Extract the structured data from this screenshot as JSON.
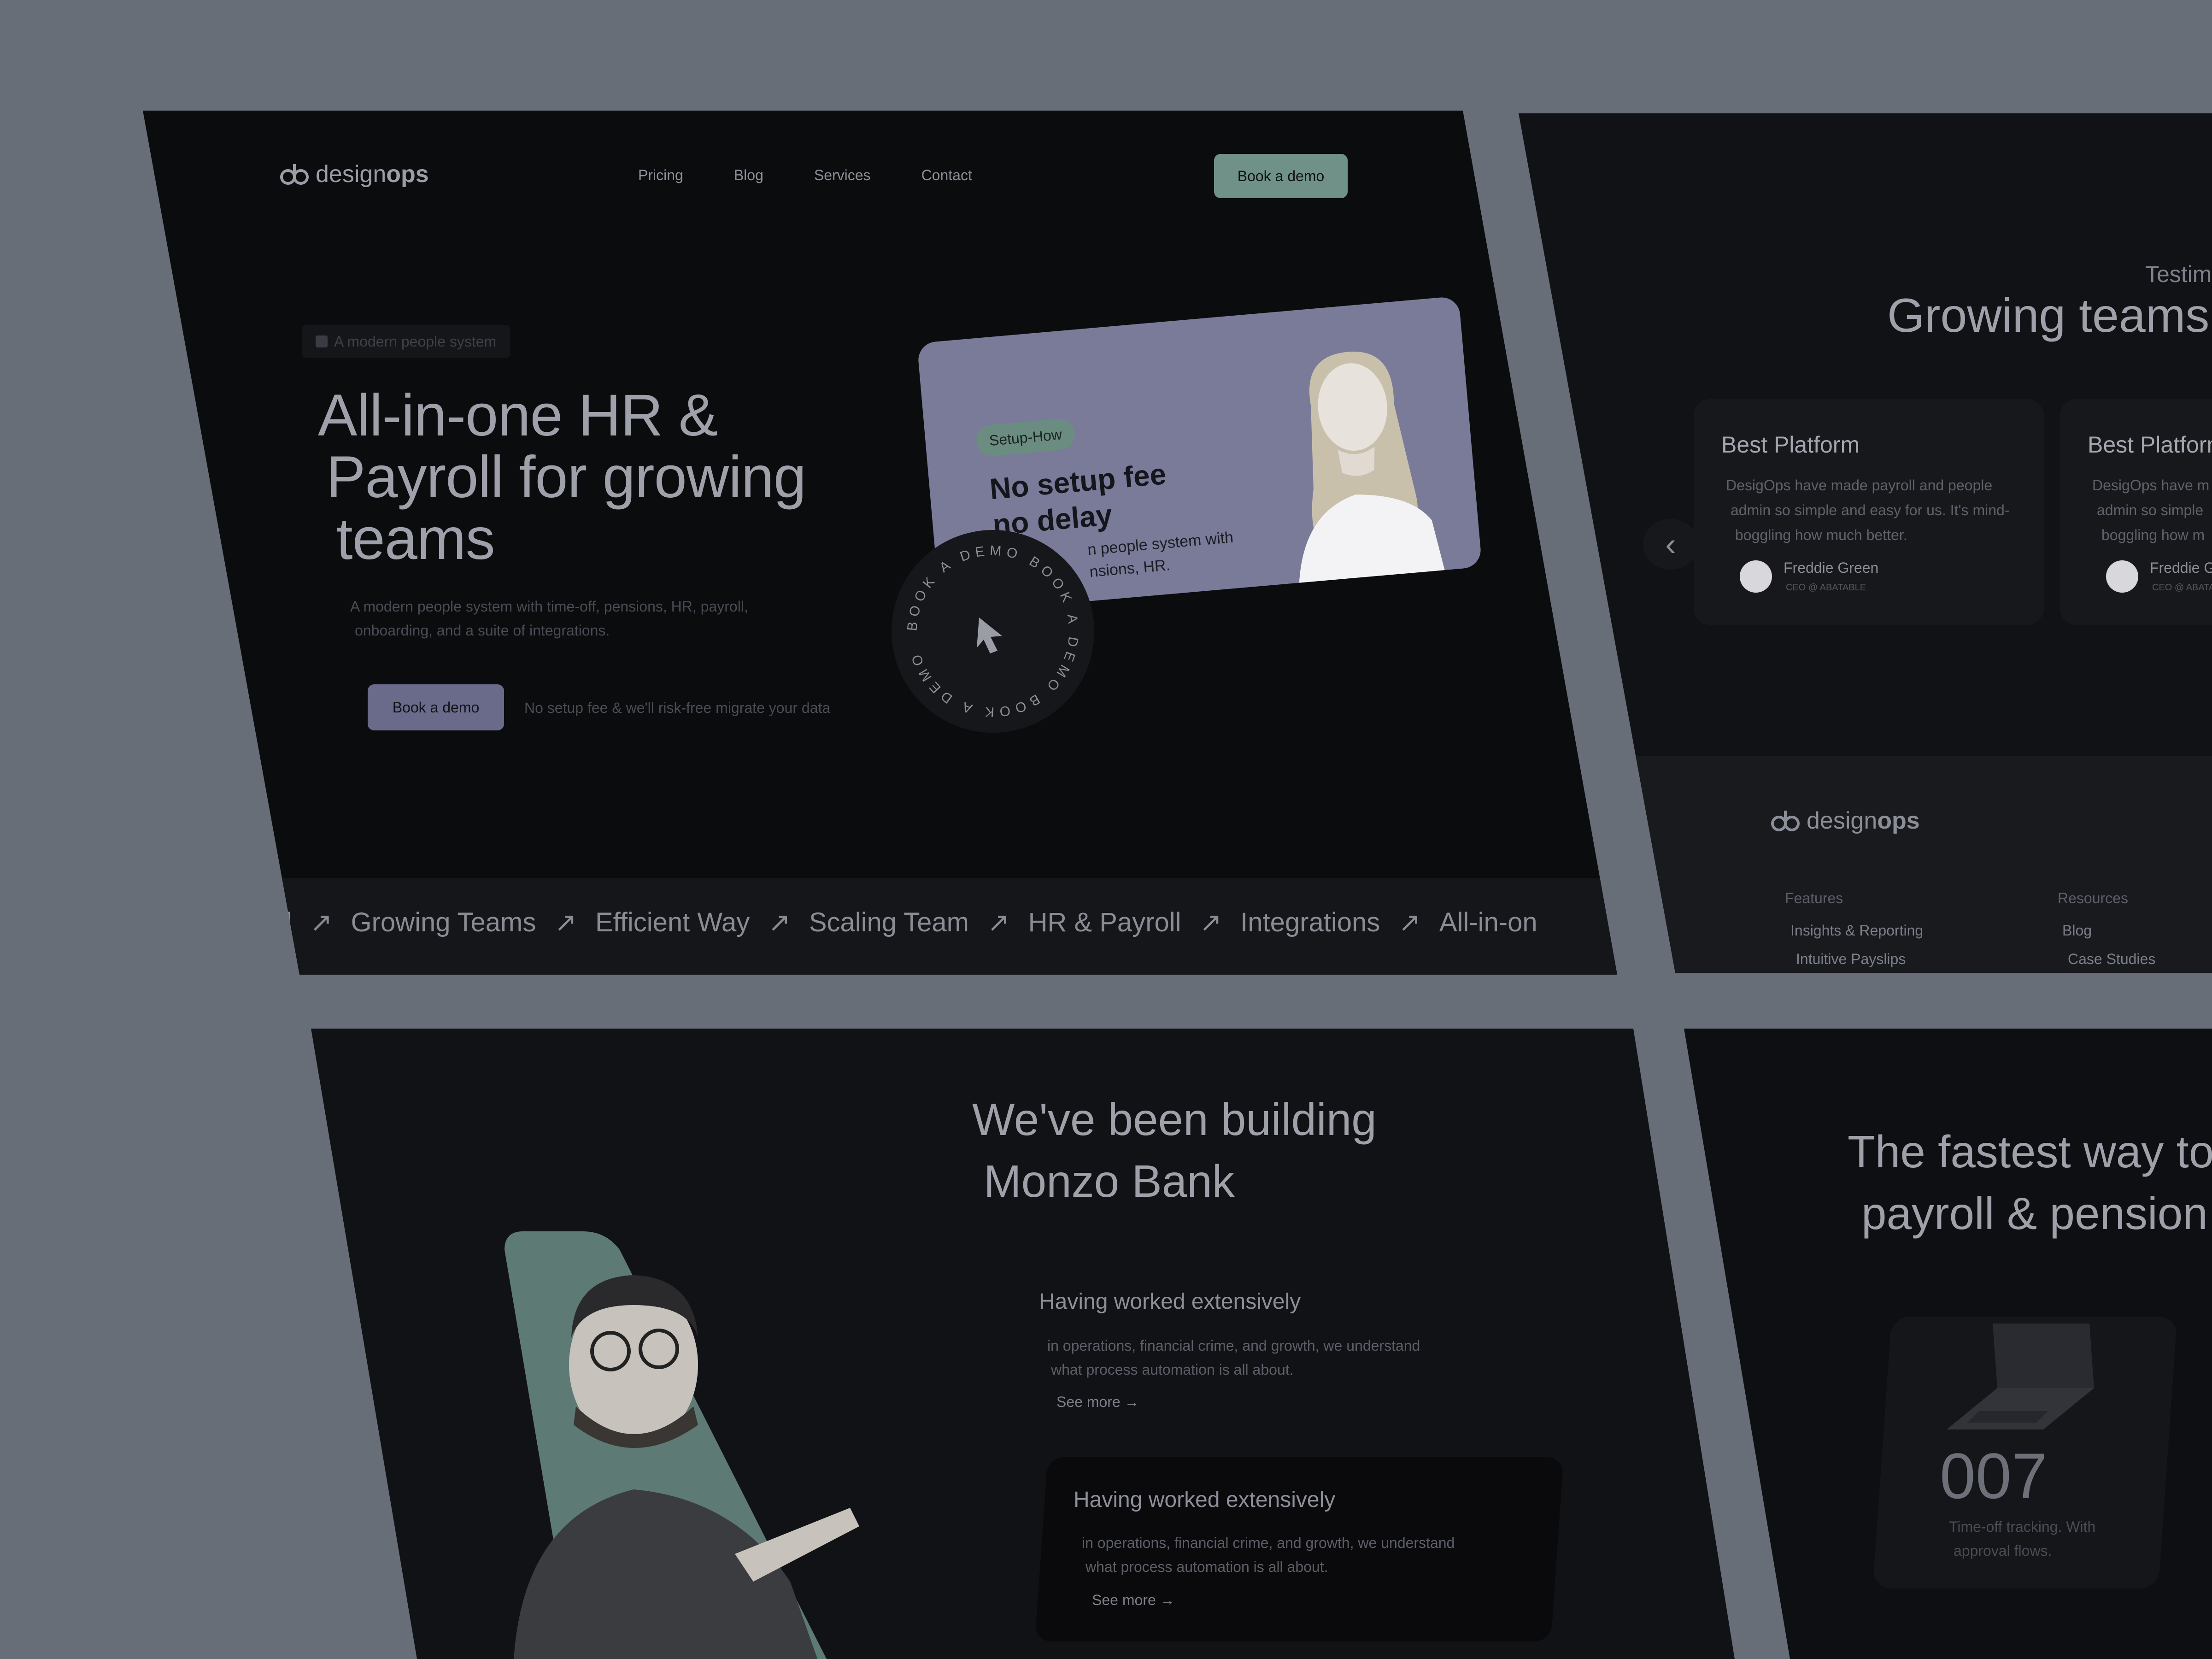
{
  "brand": {
    "logo_prefix": "design",
    "logo_suffix": "ops"
  },
  "header": {
    "nav": [
      "Pricing",
      "Blog",
      "Services",
      "Contact"
    ],
    "cta": "Book a demo"
  },
  "hero": {
    "badge": "A modern people system",
    "title_line1": "All-in-one HR &",
    "title_line2": "Payroll for growing",
    "title_line3": "teams",
    "subtitle_line1": "A modern people system with time-off, pensions, HR, payroll,",
    "subtitle_line2": "onboarding, and a suite of integrations.",
    "cta": "Book a demo",
    "cta_note": "No setup fee & we'll risk-free migrate your data"
  },
  "promo_card": {
    "tag": "Setup-How",
    "title_line1": "No setup fee",
    "title_line2": "no delay",
    "body_line1": "n people system with",
    "body_line2": "nsions, HR."
  },
  "demo_badge": {
    "ring_text": "BOOK A DEMO BOOK A DEMO BOOK A DEMO"
  },
  "marquee": [
    "l",
    "Growing Teams",
    "Efficient Way",
    "Scaling Team",
    "HR & Payroll",
    "Integrations",
    "All-in-on"
  ],
  "testimonials": {
    "eyebrow": "Testim",
    "title": "Growing teams",
    "cards": [
      {
        "title": "Best Platform",
        "body_line1": "DesigOps have made payroll and people",
        "body_line2": "admin so simple and easy for us. It's mind-",
        "body_line3": "boggling how much better.",
        "author": "Freddie Green",
        "role": "CEO @ ABATABLE"
      },
      {
        "title": "Best Platform",
        "body_line1": "DesigOps have m",
        "body_line2": "admin so simple",
        "body_line3": "boggling how m",
        "author": "Freddie G",
        "role": "CEO @ ABATA"
      }
    ],
    "prev_arrow": "‹"
  },
  "footer": {
    "col1_title": "Features",
    "col1_items": [
      "Insights & Reporting",
      "Intuitive Payslips"
    ],
    "col2_title": "Resources",
    "col2_items": [
      "Blog",
      "Case Studies"
    ]
  },
  "about": {
    "title_line1": "We've been building",
    "title_line2": "Monzo Bank",
    "block1": {
      "title": "Having worked extensively",
      "line1": "in operations, financial crime, and growth, we understand",
      "line2": "what process automation is all about.",
      "link": "See more →"
    },
    "block2": {
      "title": "Having worked extensively",
      "line1": "in operations, financial crime, and growth, we understand",
      "line2": "what process automation is all about.",
      "link": "See more →"
    }
  },
  "fastest": {
    "title_line1": "The fastest way to",
    "title_line2": "payroll & pension",
    "stat": "007",
    "stat_line1": "Time-off tracking. With",
    "stat_line2": "approval flows."
  },
  "colors": {
    "background": "#686e78",
    "panel": "#0b0c0e",
    "accent_green": "#6f9187",
    "accent_purple": "#6a6a8b",
    "card_purple": "#7a7a99"
  }
}
